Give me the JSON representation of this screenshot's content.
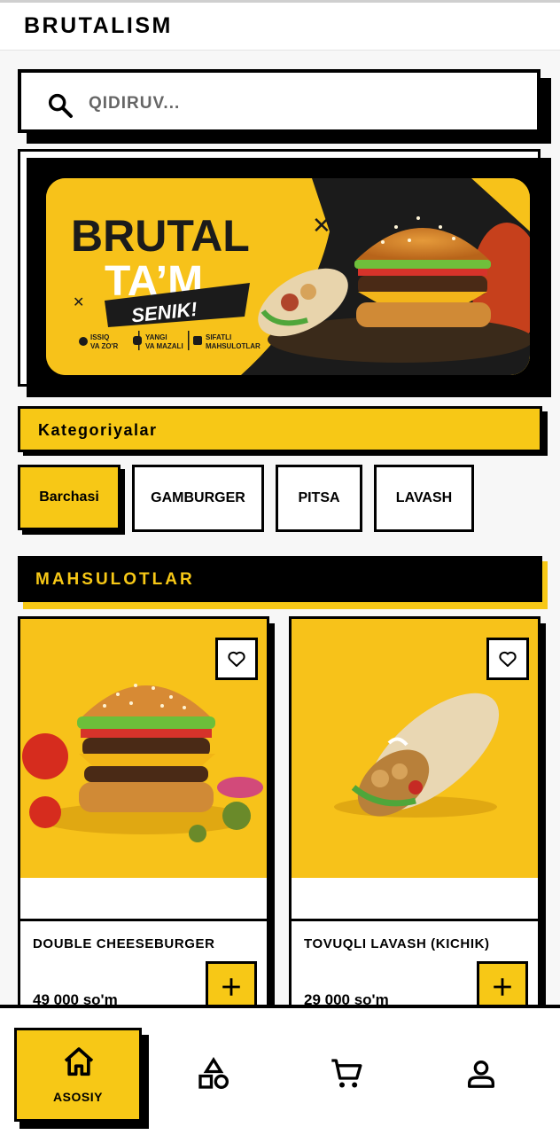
{
  "app": {
    "title": "BRUTALISM"
  },
  "search": {
    "placeholder": "QIDIRUV..."
  },
  "banner": {
    "line1": "BRUTAL",
    "line2": "TA’M",
    "line3": "SENIK!",
    "features": [
      {
        "top": "ISSIQ",
        "bottom": "VA ZO'R"
      },
      {
        "top": "YANGI",
        "bottom": "VA MAZALI"
      },
      {
        "top": "SIFATLI",
        "bottom": "MAHSULOTLAR"
      }
    ]
  },
  "categories": {
    "title": "Kategoriyalar",
    "items": [
      "Barchasi",
      "GAMBURGER",
      "PITSA",
      "LAVASH"
    ],
    "selected": "Barchasi"
  },
  "products": {
    "title": "MAHSULOTLAR",
    "items": [
      {
        "name": "DOUBLE CHEESEBURGER",
        "price": "49 000 so'm"
      },
      {
        "name": "TOVUQLI LAVASH (KICHIK)",
        "price": "29 000 so'm"
      }
    ]
  },
  "nav": {
    "home_label": "ASOSIY"
  },
  "icons": [
    "search-icon",
    "heart-icon",
    "plus-icon",
    "home-icon",
    "shapes-icon",
    "cart-icon",
    "user-icon"
  ],
  "colors": {
    "accent": "#f7c816",
    "ink": "#000000",
    "background": "#f7f7f7"
  }
}
